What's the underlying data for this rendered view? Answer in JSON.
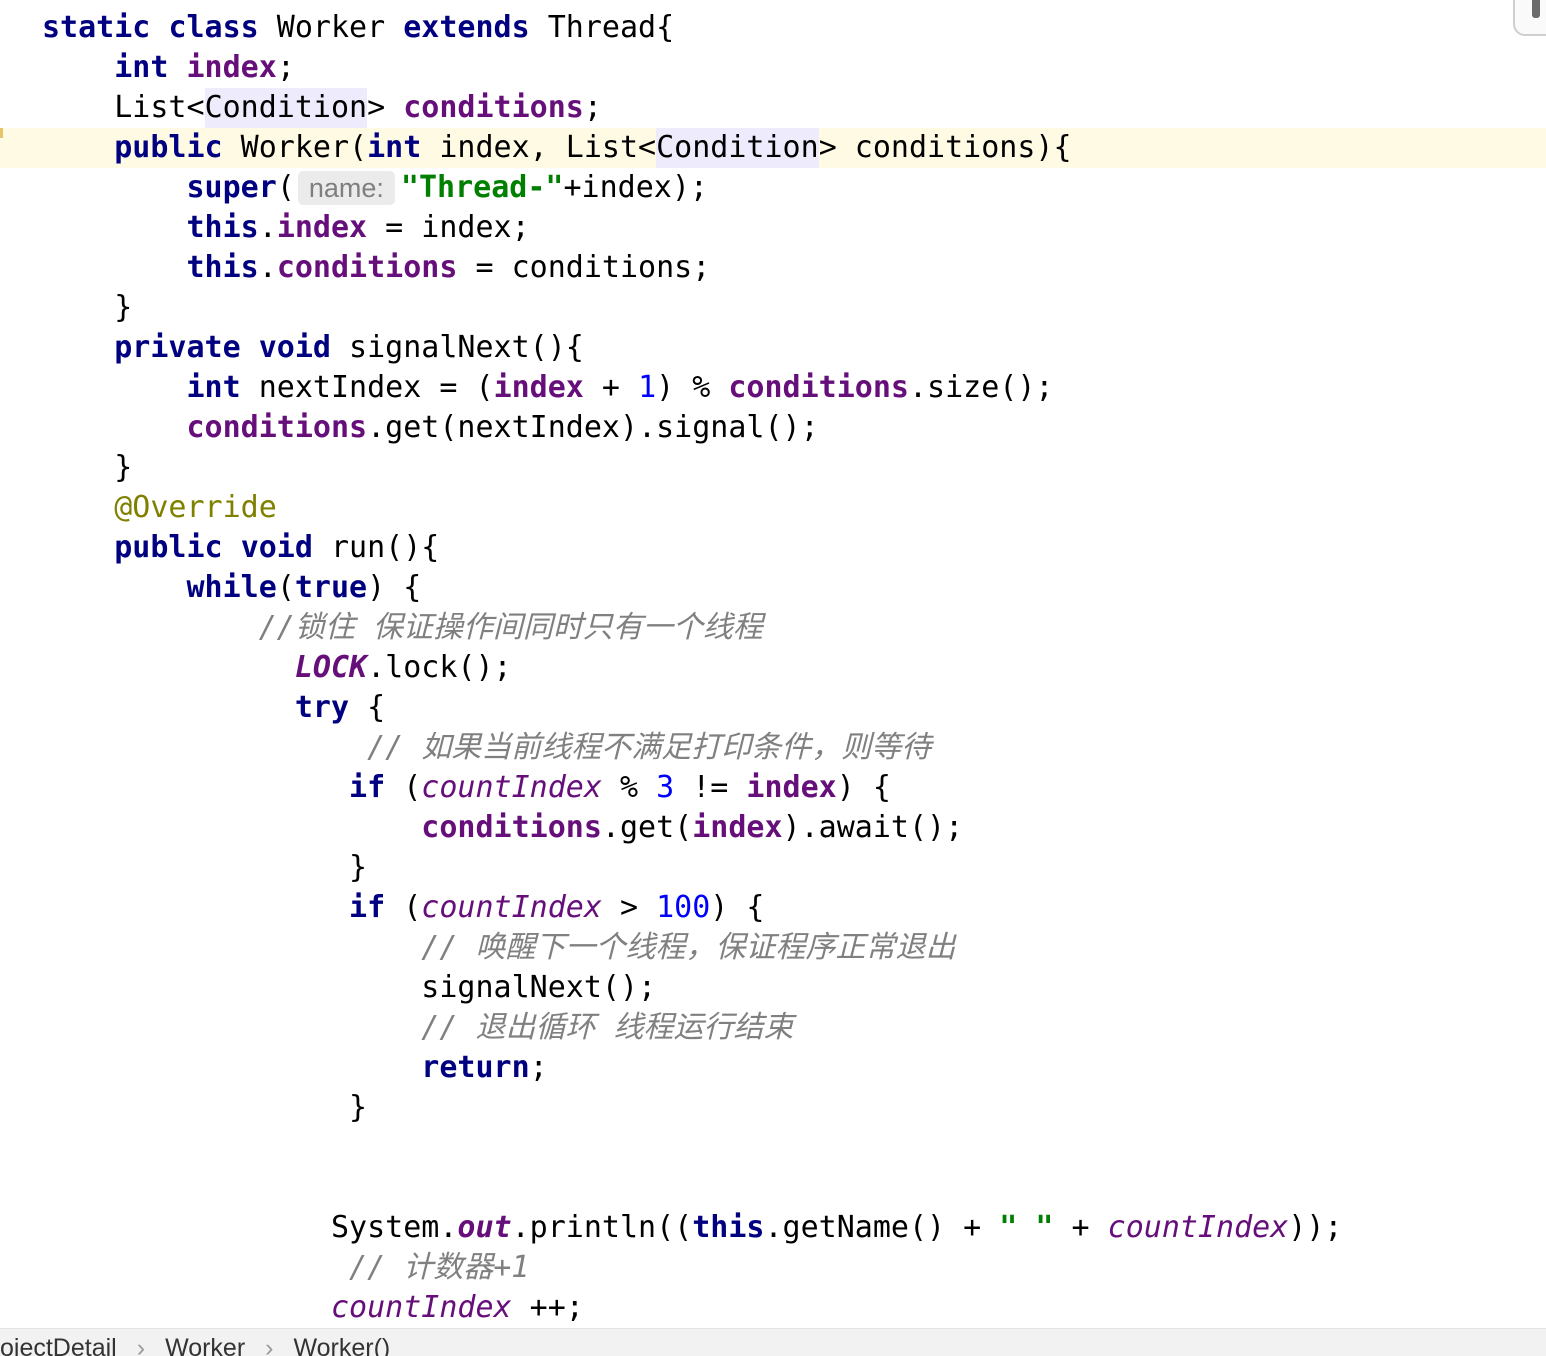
{
  "syntax_colors": {
    "keyword": "#000080",
    "field": "#660e7a",
    "static_field": "#660e7a",
    "constant": "#660e7a",
    "string": "#008000",
    "number": "#0000ff",
    "comment": "#808080",
    "annotation": "#808000",
    "plain": "#000000",
    "param_hint": "#7f7f7f",
    "usage_highlight": "#000000"
  },
  "backgrounds": {
    "current_line": "#fffae3",
    "usage_highlight": "#edebfc",
    "param_hint": "#ebebeb"
  },
  "editor": {
    "lines": [
      {
        "tokens": [
          {
            "keyword": "static"
          },
          {
            "plain": " "
          },
          {
            "keyword": "class"
          },
          {
            "plain": " Worker "
          },
          {
            "keyword": "extends"
          },
          {
            "plain": " Thread{"
          }
        ]
      },
      {
        "tokens": [
          {
            "plain": "    "
          },
          {
            "keyword": "int"
          },
          {
            "plain": " "
          },
          {
            "field": "index"
          },
          {
            "plain": ";"
          }
        ]
      },
      {
        "tokens": [
          {
            "plain": "    List<"
          },
          {
            "usage_highlight": "Condition"
          },
          {
            "plain": "> "
          },
          {
            "field": "conditions"
          },
          {
            "plain": ";"
          }
        ]
      },
      {
        "current": true,
        "tokens": [
          {
            "plain": "    "
          },
          {
            "keyword": "public"
          },
          {
            "plain": " Worker("
          },
          {
            "keyword": "int"
          },
          {
            "plain": " index, List<"
          },
          {
            "usage_highlight": "Condition"
          },
          {
            "plain": "> conditions){"
          }
        ]
      },
      {
        "tokens": [
          {
            "plain": "        "
          },
          {
            "keyword": "super"
          },
          {
            "plain": "("
          },
          {
            "param_hint": "name:"
          },
          {
            "string": "\"Thread-\""
          },
          {
            "plain": "+index);"
          }
        ]
      },
      {
        "tokens": [
          {
            "plain": "        "
          },
          {
            "keyword": "this"
          },
          {
            "plain": "."
          },
          {
            "field": "index"
          },
          {
            "plain": " = index;"
          }
        ]
      },
      {
        "tokens": [
          {
            "plain": "        "
          },
          {
            "keyword": "this"
          },
          {
            "plain": "."
          },
          {
            "field": "conditions"
          },
          {
            "plain": " = conditions;"
          }
        ]
      },
      {
        "tokens": [
          {
            "plain": "    }"
          }
        ]
      },
      {
        "tokens": [
          {
            "plain": "    "
          },
          {
            "keyword": "private"
          },
          {
            "plain": " "
          },
          {
            "keyword": "void"
          },
          {
            "plain": " signalNext(){"
          }
        ]
      },
      {
        "tokens": [
          {
            "plain": "        "
          },
          {
            "keyword": "int"
          },
          {
            "plain": " nextIndex = ("
          },
          {
            "field": "index"
          },
          {
            "plain": " + "
          },
          {
            "number": "1"
          },
          {
            "plain": ") % "
          },
          {
            "field": "conditions"
          },
          {
            "plain": ".size();"
          }
        ]
      },
      {
        "tokens": [
          {
            "plain": "        "
          },
          {
            "field": "conditions"
          },
          {
            "plain": ".get(nextIndex).signal();"
          }
        ]
      },
      {
        "tokens": [
          {
            "plain": "    }"
          }
        ]
      },
      {
        "tokens": [
          {
            "plain": "    "
          },
          {
            "annotation": "@Override"
          }
        ]
      },
      {
        "tokens": [
          {
            "plain": "    "
          },
          {
            "keyword": "public"
          },
          {
            "plain": " "
          },
          {
            "keyword": "void"
          },
          {
            "plain": " run(){"
          }
        ]
      },
      {
        "tokens": [
          {
            "plain": "        "
          },
          {
            "keyword": "while"
          },
          {
            "plain": "("
          },
          {
            "keyword": "true"
          },
          {
            "plain": ") {"
          }
        ]
      },
      {
        "tokens": [
          {
            "plain": "            "
          },
          {
            "comment": "//锁住 保证操作间同时只有一个线程"
          }
        ]
      },
      {
        "tokens": [
          {
            "plain": "              "
          },
          {
            "constant": "LOCK"
          },
          {
            "plain": ".lock();"
          }
        ]
      },
      {
        "tokens": [
          {
            "plain": "              "
          },
          {
            "keyword": "try"
          },
          {
            "plain": " {"
          }
        ]
      },
      {
        "tokens": [
          {
            "plain": "                  "
          },
          {
            "comment": "// 如果当前线程不满足打印条件，则等待"
          }
        ]
      },
      {
        "tokens": [
          {
            "plain": "                 "
          },
          {
            "keyword": "if"
          },
          {
            "plain": " ("
          },
          {
            "static_field": "countIndex"
          },
          {
            "plain": " % "
          },
          {
            "number": "3"
          },
          {
            "plain": " != "
          },
          {
            "field": "index"
          },
          {
            "plain": ") {"
          }
        ]
      },
      {
        "tokens": [
          {
            "plain": "                     "
          },
          {
            "field": "conditions"
          },
          {
            "plain": ".get("
          },
          {
            "field": "index"
          },
          {
            "plain": ").await();"
          }
        ]
      },
      {
        "tokens": [
          {
            "plain": "                 }"
          }
        ]
      },
      {
        "tokens": [
          {
            "plain": "                 "
          },
          {
            "keyword": "if"
          },
          {
            "plain": " ("
          },
          {
            "static_field": "countIndex"
          },
          {
            "plain": " > "
          },
          {
            "number": "100"
          },
          {
            "plain": ") {"
          }
        ]
      },
      {
        "tokens": [
          {
            "plain": "                     "
          },
          {
            "comment": "// 唤醒下一个线程，保证程序正常退出"
          }
        ]
      },
      {
        "tokens": [
          {
            "plain": "                     signalNext();"
          }
        ]
      },
      {
        "tokens": [
          {
            "plain": "                     "
          },
          {
            "comment": "// 退出循环 线程运行结束"
          }
        ]
      },
      {
        "tokens": [
          {
            "plain": "                     "
          },
          {
            "keyword": "return"
          },
          {
            "plain": ";"
          }
        ]
      },
      {
        "tokens": [
          {
            "plain": "                 }"
          }
        ]
      },
      {
        "tokens": []
      },
      {
        "tokens": []
      },
      {
        "tokens": [
          {
            "plain": "                System."
          },
          {
            "constant": "out"
          },
          {
            "plain": ".println(("
          },
          {
            "keyword": "this"
          },
          {
            "plain": ".getName() + "
          },
          {
            "string": "\" \""
          },
          {
            "plain": " + "
          },
          {
            "static_field": "countIndex"
          },
          {
            "plain": "));"
          }
        ]
      },
      {
        "tokens": [
          {
            "plain": "                 "
          },
          {
            "comment": "// 计数器+1"
          }
        ]
      },
      {
        "tokens": [
          {
            "plain": "                "
          },
          {
            "static_field": "countIndex"
          },
          {
            "plain": " ++;"
          }
        ]
      }
    ]
  },
  "breadcrumb": {
    "items": [
      "ojectDetail",
      "Worker",
      "Worker()"
    ],
    "separator": "›"
  }
}
